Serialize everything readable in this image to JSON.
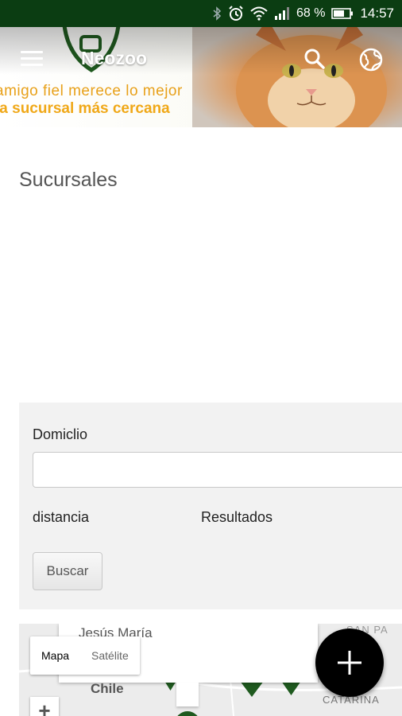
{
  "status_bar": {
    "battery": "68 %",
    "time": "14:57",
    "icons": [
      "bluetooth-icon",
      "alarm-icon",
      "wifi-icon",
      "signal-icon",
      "battery-icon"
    ]
  },
  "app_bar": {
    "title": "Neozoo",
    "icons": [
      "menu-icon",
      "search-icon",
      "globe-icon"
    ]
  },
  "banner": {
    "slogan_line1": "amigo fiel merece lo mejor",
    "slogan_line2": "la sucursal más cercana",
    "accent_color": "#f0a818"
  },
  "page": {
    "title": "Sucursales"
  },
  "form": {
    "address_label": "Domiclio",
    "address_value": "",
    "distance_label": "distancia",
    "results_label": "Resultados",
    "search_button": "Buscar"
  },
  "map": {
    "type_options": [
      "Mapa",
      "Satélite"
    ],
    "selected_type": "Mapa",
    "labels": [
      "Jesús María",
      "Chile",
      "SAN PA",
      "CATARINA"
    ],
    "zoom_in": "+",
    "marker_color": "#1f5a1f"
  },
  "fab": {
    "icon": "plus-icon"
  },
  "colors": {
    "status_bar": "#0b3d12",
    "brand_green": "#1f5a1f"
  }
}
